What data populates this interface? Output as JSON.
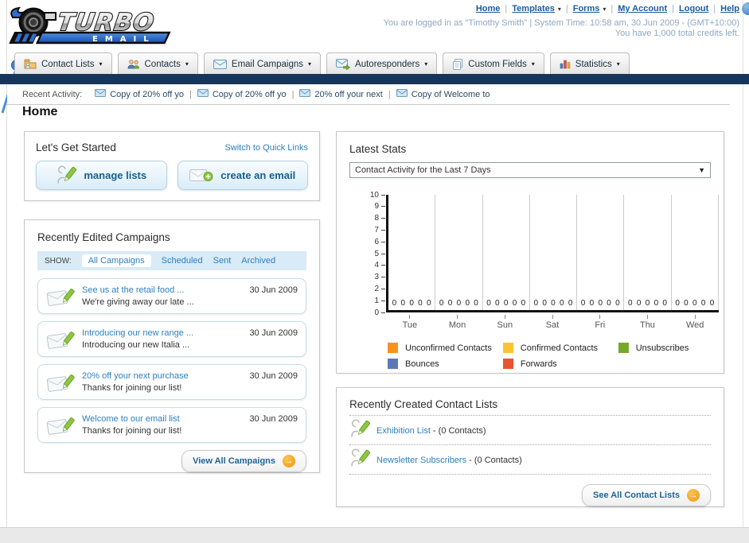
{
  "header": {
    "logo_title": "TURBO",
    "logo_subtitle": "EMAIL",
    "nav": [
      {
        "label": "Home",
        "dropdown": false
      },
      {
        "label": "Templates",
        "dropdown": true
      },
      {
        "label": "Forms",
        "dropdown": true
      },
      {
        "label": "My Account",
        "dropdown": false
      },
      {
        "label": "Logout",
        "dropdown": false
      },
      {
        "label": "Help",
        "dropdown": false
      }
    ],
    "login_line": "You are logged in as \"Timothy Smith\" | System Time: 10:58 am, 30 Jun 2009 - (GMT+10:00)",
    "credits_line": "You have 1,000 total credits left."
  },
  "nav_tabs": [
    {
      "label": "Contact Lists",
      "icon": "contact-lists-icon"
    },
    {
      "label": "Contacts",
      "icon": "contacts-icon"
    },
    {
      "label": "Email Campaigns",
      "icon": "email-campaigns-icon"
    },
    {
      "label": "Autoresponders",
      "icon": "autoresponders-icon"
    },
    {
      "label": "Custom Fields",
      "icon": "custom-fields-icon"
    },
    {
      "label": "Statistics",
      "icon": "statistics-icon"
    }
  ],
  "recent_activity": {
    "label": "Recent Activity:",
    "items": [
      "Copy of 20% off yo",
      "Copy of 20% off yo",
      "20% off your next",
      "Copy of Welcome to"
    ]
  },
  "page_title": "Home",
  "get_started": {
    "title": "Let's Get Started",
    "switch_link": "Switch to Quick Links",
    "buttons": [
      {
        "label": "manage lists"
      },
      {
        "label": "create an email"
      }
    ]
  },
  "campaigns": {
    "title": "Recently Edited Campaigns",
    "show_label": "SHOW:",
    "tabs": [
      {
        "label": "All Campaigns",
        "active": true
      },
      {
        "label": "Scheduled",
        "active": false
      },
      {
        "label": "Sent",
        "active": false
      },
      {
        "label": "Archived",
        "active": false
      }
    ],
    "items": [
      {
        "title": "See us at the retail food ...",
        "subtitle": "We're giving away our late ...",
        "date": "30 Jun 2009"
      },
      {
        "title": "Introducing our new range ...",
        "subtitle": "Introducing our new Italia ...",
        "date": "30 Jun 2009"
      },
      {
        "title": "20% off your next purchase",
        "subtitle": "Thanks for joining our list!",
        "date": "30 Jun 2009"
      },
      {
        "title": "Welcome to our email list",
        "subtitle": "Thanks for joining our list!",
        "date": "30 Jun 2009"
      }
    ],
    "view_all_label": "View All Campaigns"
  },
  "stats": {
    "title": "Latest Stats",
    "dropdown_value": "Contact Activity for the Last 7 Days"
  },
  "chart_data": {
    "type": "bar",
    "title": "Contact Activity for the Last 7 Days",
    "categories": [
      "Tue",
      "Mon",
      "Sun",
      "Sat",
      "Fri",
      "Thu",
      "Wed"
    ],
    "series": [
      {
        "name": "Unconfirmed Contacts",
        "color": "#F6921E",
        "values": [
          0,
          0,
          0,
          0,
          0,
          0,
          0
        ]
      },
      {
        "name": "Confirmed Contacts",
        "color": "#FDC431",
        "values": [
          0,
          0,
          0,
          0,
          0,
          0,
          0
        ]
      },
      {
        "name": "Unsubscribes",
        "color": "#76A82C",
        "values": [
          0,
          0,
          0,
          0,
          0,
          0,
          0
        ]
      },
      {
        "name": "Bounces",
        "color": "#5D79B4",
        "values": [
          0,
          0,
          0,
          0,
          0,
          0,
          0
        ]
      },
      {
        "name": "Forwards",
        "color": "#E8542C",
        "values": [
          0,
          0,
          0,
          0,
          0,
          0,
          0
        ]
      }
    ],
    "xlabel": "",
    "ylabel": "",
    "ylim": [
      0,
      10
    ],
    "yticks": [
      0,
      1,
      2,
      3,
      4,
      5,
      6,
      7,
      8,
      9,
      10
    ],
    "grid": "vertical",
    "legend_position": "bottom",
    "value_labels": "0 shown for each series in each day group"
  },
  "contact_lists": {
    "title": "Recently Created Contact Lists",
    "items": [
      {
        "name": "Exhibition List",
        "detail": " - (0 Contacts)"
      },
      {
        "name": "Newsletter Subscribers",
        "detail": " - (0 Contacts)"
      }
    ],
    "see_all_label": "See All Contact Lists"
  }
}
